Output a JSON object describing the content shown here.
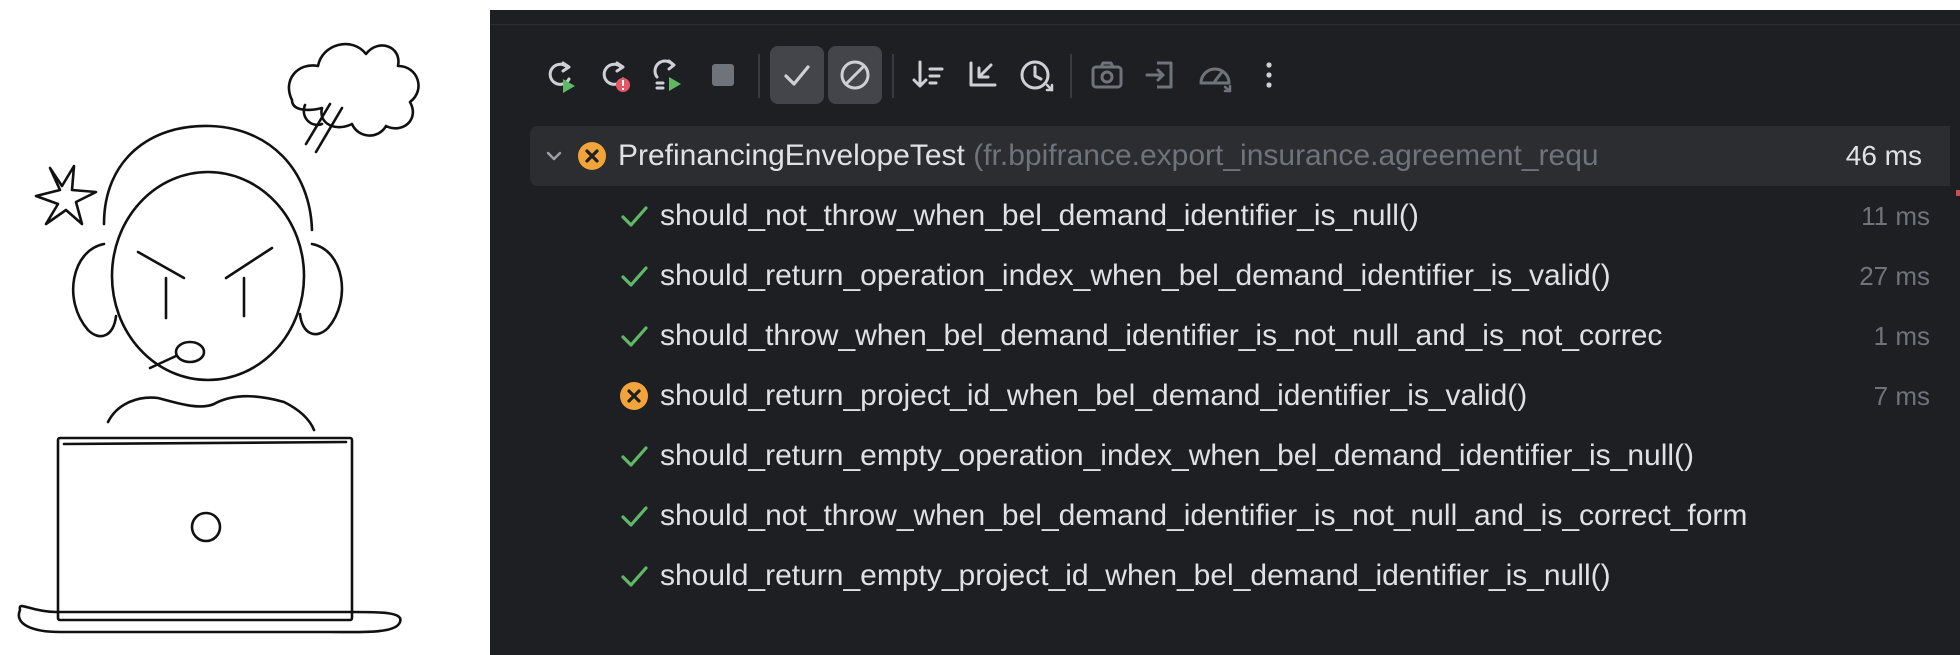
{
  "toolbar": {
    "buttons": [
      {
        "icon": "rerun-icon",
        "toggled": false
      },
      {
        "icon": "rerun-failed-icon",
        "toggled": false
      },
      {
        "icon": "rerun-automatically-icon",
        "toggled": false
      },
      {
        "icon": "stop-icon",
        "toggled": false
      },
      {
        "icon": "show-passed-icon",
        "toggled": true
      },
      {
        "icon": "show-ignored-icon",
        "toggled": true
      },
      {
        "icon": "sort-alphabetically-icon",
        "toggled": false
      },
      {
        "icon": "collapse-all-icon",
        "toggled": false
      },
      {
        "icon": "sort-by-duration-icon",
        "toggled": false
      },
      {
        "icon": "screenshot-icon",
        "toggled": false
      },
      {
        "icon": "import-tests-icon",
        "toggled": false
      },
      {
        "icon": "test-history-icon",
        "toggled": false
      },
      {
        "icon": "more-options-icon",
        "toggled": false
      }
    ]
  },
  "suite": {
    "name": "PrefinancingEnvelopeTest",
    "package": " (fr.bpifrance.export_insurance.agreement_requ",
    "duration": "46 ms",
    "status": "failed"
  },
  "tests": [
    {
      "name": "should_not_throw_when_bel_demand_identifier_is_null()",
      "duration": "11 ms",
      "status": "passed"
    },
    {
      "name": "should_return_operation_index_when_bel_demand_identifier_is_valid()",
      "duration": "27 ms",
      "status": "passed"
    },
    {
      "name": "should_throw_when_bel_demand_identifier_is_not_null_and_is_not_correc",
      "duration": "1 ms",
      "status": "passed"
    },
    {
      "name": "should_return_project_id_when_bel_demand_identifier_is_valid()",
      "duration": "7 ms",
      "status": "failed"
    },
    {
      "name": "should_return_empty_operation_index_when_bel_demand_identifier_is_null()",
      "duration": "",
      "status": "passed"
    },
    {
      "name": "should_not_throw_when_bel_demand_identifier_is_not_null_and_is_correct_form",
      "duration": "",
      "status": "passed"
    },
    {
      "name": "should_return_empty_project_id_when_bel_demand_identifier_is_null()",
      "duration": "",
      "status": "passed"
    }
  ],
  "colors": {
    "panel_bg": "#1e1f22",
    "suite_row_bg": "#2b2d30",
    "pass_green": "#5fb865",
    "fail_orange": "#f2a43a",
    "text": "#dfe1e5",
    "muted": "#6f737a"
  }
}
